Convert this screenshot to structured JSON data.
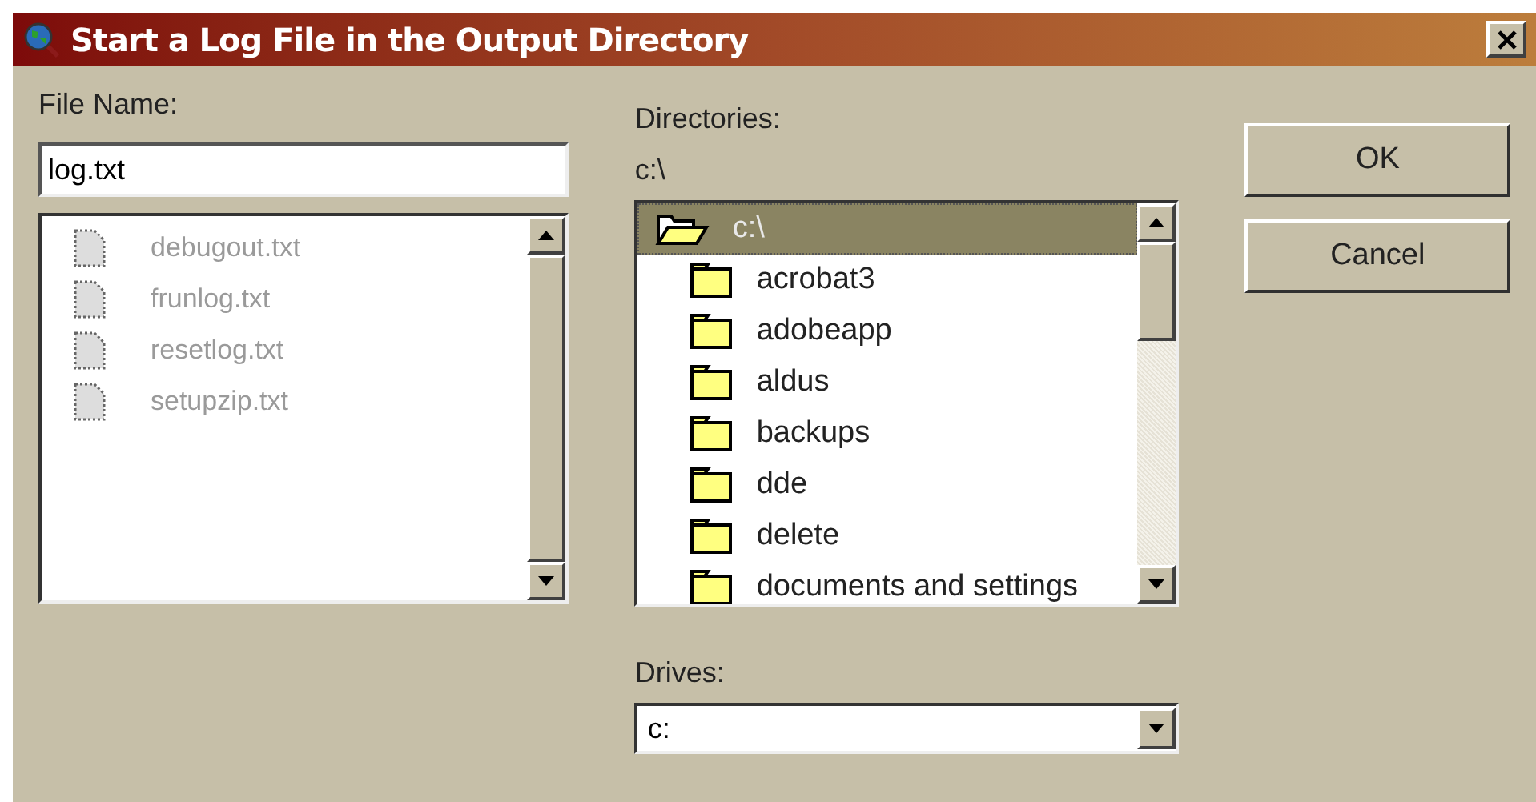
{
  "window": {
    "title": "Start a Log File in the Output Directory"
  },
  "file_name": {
    "label": "File Name:",
    "value": "log.txt"
  },
  "files": [
    {
      "name": "debugout.txt",
      "disabled": true
    },
    {
      "name": "frunlog.txt",
      "disabled": true
    },
    {
      "name": "resetlog.txt",
      "disabled": true
    },
    {
      "name": "setupzip.txt",
      "disabled": true
    }
  ],
  "directories": {
    "label": "Directories:",
    "path": "c:\\",
    "tree": [
      {
        "name": "c:\\",
        "selected": true,
        "expanded": true,
        "children": [
          {
            "name": "acrobat3",
            "selected": false,
            "expanded": false
          },
          {
            "name": "adobeapp",
            "selected": false,
            "expanded": false
          },
          {
            "name": "aldus",
            "selected": false,
            "expanded": false
          },
          {
            "name": "backups",
            "selected": false,
            "expanded": false
          },
          {
            "name": "dde",
            "selected": false,
            "expanded": false
          },
          {
            "name": "delete",
            "selected": false,
            "expanded": false
          },
          {
            "name": "documents and settings",
            "selected": false,
            "expanded": false
          }
        ]
      }
    ]
  },
  "drives": {
    "label": "Drives:",
    "value": "c:"
  },
  "buttons": [
    {
      "label": "OK"
    },
    {
      "label": "Cancel"
    }
  ]
}
